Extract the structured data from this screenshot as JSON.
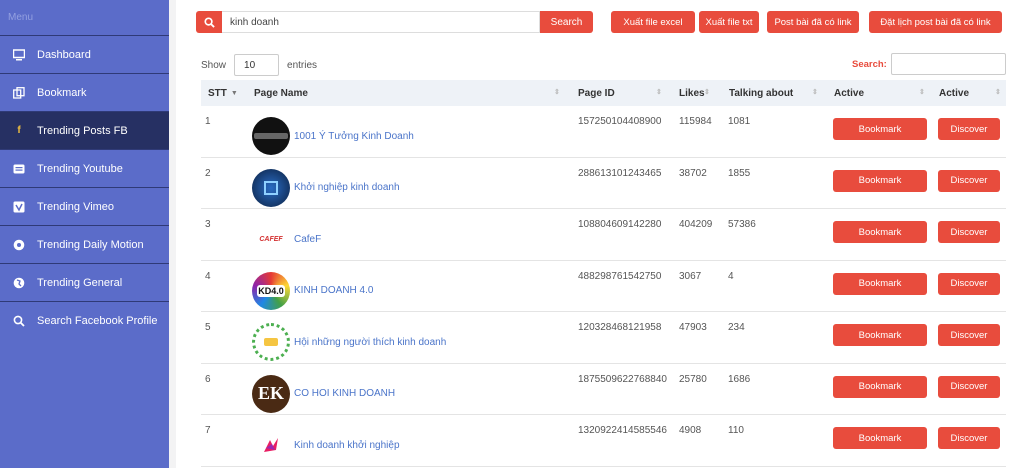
{
  "sidebar": {
    "title": "Menu",
    "items": [
      {
        "label": "Dashboard",
        "icon": "monitor-icon"
      },
      {
        "label": "Bookmark",
        "icon": "copy-icon"
      },
      {
        "label": "Trending Posts FB",
        "icon": "facebook-icon",
        "active": true
      },
      {
        "label": "Trending Youtube",
        "icon": "youtube-icon"
      },
      {
        "label": "Trending Vimeo",
        "icon": "vimeo-icon"
      },
      {
        "label": "Trending Daily Motion",
        "icon": "dailymotion-icon"
      },
      {
        "label": "Trending General",
        "icon": "globe-icon"
      },
      {
        "label": "Search Facebook Profile",
        "icon": "search-icon"
      }
    ]
  },
  "toolbar": {
    "search_value": "kinh doanh",
    "search_button": "Search",
    "export_excel": "Xuất file excel",
    "export_txt": "Xuất file txt",
    "post_link": "Post bài đã có link",
    "schedule_post": "Đặt lịch post bài đã có link"
  },
  "table_controls": {
    "show_label": "Show",
    "entries_value": "10",
    "entries_label": "entries",
    "search_label": "Search:"
  },
  "table": {
    "headers": {
      "stt": "STT",
      "page_name": "Page Name",
      "page_id": "Page ID",
      "likes": "Likes",
      "talking": "Talking about",
      "active1": "Active",
      "active2": "Active"
    },
    "bookmark_label": "Bookmark",
    "discover_label": "Discover",
    "rows": [
      {
        "stt": "1",
        "name": "1001 Ý Tưởng Kinh Doanh",
        "page_id": "157250104408900",
        "likes": "115984",
        "talking": "1081"
      },
      {
        "stt": "2",
        "name": "Khởi nghiệp kinh doanh",
        "page_id": "288613101243465",
        "likes": "38702",
        "talking": "1855"
      },
      {
        "stt": "3",
        "name": "CafeF",
        "page_id": "108804609142280",
        "likes": "404209",
        "talking": "57386"
      },
      {
        "stt": "4",
        "name": "KINH DOANH 4.0",
        "page_id": "488298761542750",
        "likes": "3067",
        "talking": "4"
      },
      {
        "stt": "5",
        "name": "Hội những người thích kinh doanh",
        "page_id": "120328468121958",
        "likes": "47903",
        "talking": "234"
      },
      {
        "stt": "6",
        "name": "CO HOI KINH DOANH",
        "page_id": "1875509622768840",
        "likes": "25780",
        "talking": "1686"
      },
      {
        "stt": "7",
        "name": "Kinh doanh khởi nghiệp",
        "page_id": "1320922414585546",
        "likes": "4908",
        "talking": "110"
      }
    ],
    "logo_text": {
      "cafef": "CAFEF",
      "kd40": "KD4.0",
      "ek": "EK"
    }
  },
  "colors": {
    "accent": "#e84c3d",
    "sidebar": "#5b6cc9",
    "sidebar_active": "#263063",
    "link": "#4a74c9"
  }
}
